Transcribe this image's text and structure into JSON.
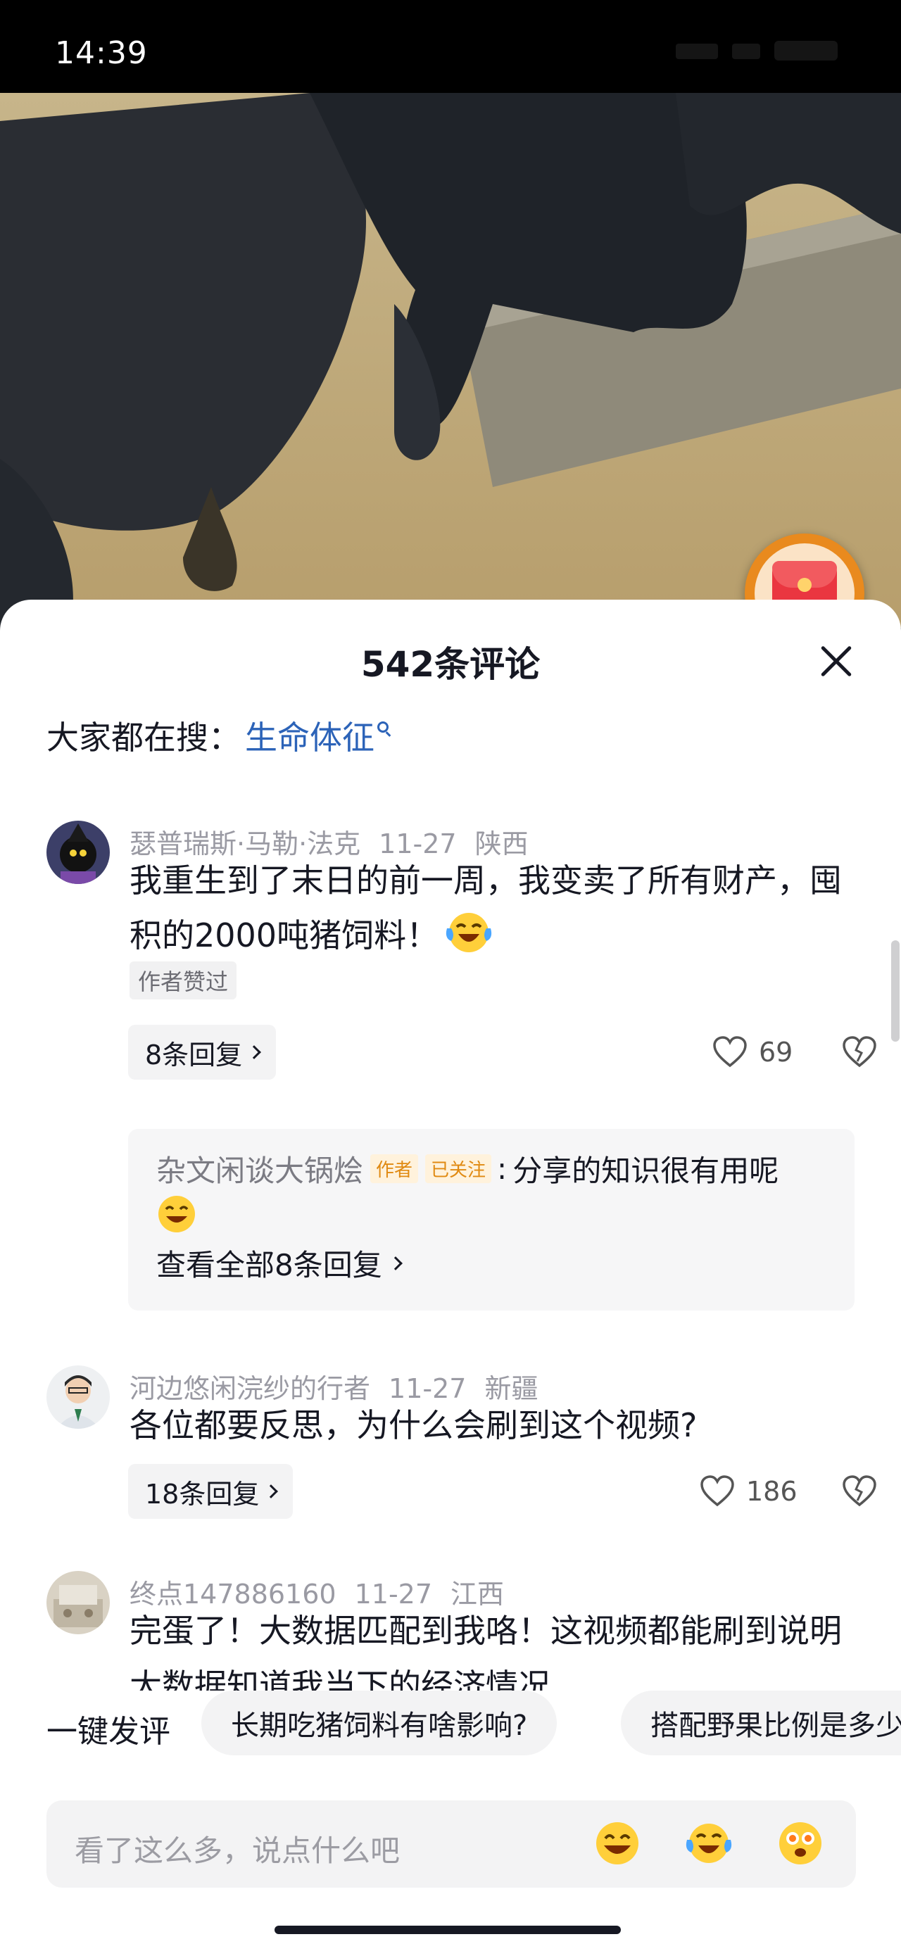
{
  "status_bar": {
    "time": "14:39"
  },
  "sheet": {
    "title": "542条评论",
    "search_prefix": "大家都在搜：",
    "search_keyword": "生命体征"
  },
  "comments": [
    {
      "username": "瑟普瑞斯·马勒·法克",
      "date": "11-27",
      "location": "陕西",
      "text": "我重生到了末日的前一周，我变卖了所有财产，囤积的2000吨猪饲料！",
      "tag": "作者赞过",
      "reply_label": "8条回复",
      "likes": "69",
      "reply": {
        "name": "杂文闲谈大锅烩",
        "badge_author": "作者",
        "badge_followed": "已关注",
        "text": "分享的知识很有用呢",
        "view_all": "查看全部8条回复"
      }
    },
    {
      "username": "河边悠闲浣纱的行者",
      "date": "11-27",
      "location": "新疆",
      "text": "各位都要反思，为什么会刷到这个视频?",
      "reply_label": "18条回复",
      "likes": "186"
    },
    {
      "username": "终点147886160",
      "date": "11-27",
      "location": "江西",
      "text": "完蛋了！大数据匹配到我咯！这视频都能刷到说明大数据知道我当下的经济情况"
    }
  ],
  "quick_comment": {
    "label": "一键发评",
    "chips": [
      "长期吃猪饲料有啥影响?",
      "搭配野果比例是多少"
    ]
  },
  "input": {
    "placeholder": "看了这么多，说点什么吧"
  },
  "colors": {
    "link": "#2c63b8",
    "badge": "#e08a12",
    "redpacket": "#e98a1e"
  }
}
